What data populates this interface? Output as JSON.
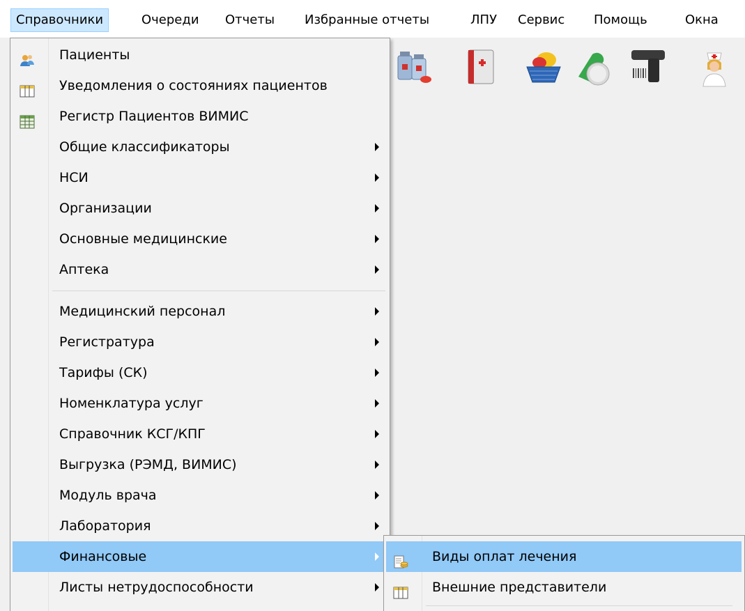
{
  "menubar": {
    "items": [
      {
        "label": "Справочники"
      },
      {
        "label": "Очереди"
      },
      {
        "label": "Отчеты"
      },
      {
        "label": "Избранные отчеты"
      },
      {
        "label": "ЛПУ"
      },
      {
        "label": "Сервис"
      },
      {
        "label": "Помощь"
      },
      {
        "label": "Окна"
      }
    ]
  },
  "toolbar": {
    "icons": [
      "medicine-vials-icon",
      "first-aid-book-icon",
      "pills-basket-icon",
      "capsule-tablet-icon",
      "barcode-scanner-icon",
      "nurse-icon"
    ]
  },
  "menu": {
    "items": [
      {
        "label": "Пациенты",
        "icon": "patients-icon",
        "has_submenu": false
      },
      {
        "label": "Уведомления о состояниях пациентов",
        "icon": "table-columns-icon",
        "has_submenu": false
      },
      {
        "label": "Регистр Пациентов ВИМИС",
        "icon": "spreadsheet-icon",
        "has_submenu": false
      },
      {
        "label": "Общие классификаторы",
        "has_submenu": true
      },
      {
        "label": "НСИ",
        "has_submenu": true
      },
      {
        "label": "Организации",
        "has_submenu": true
      },
      {
        "label": "Основные медицинские",
        "has_submenu": true
      },
      {
        "label": "Аптека",
        "has_submenu": true
      },
      {
        "label": "Медицинский персонал",
        "has_submenu": true
      },
      {
        "label": "Регистратура",
        "has_submenu": true
      },
      {
        "label": "Тарифы (СК)",
        "has_submenu": true
      },
      {
        "label": "Номенклатура услуг",
        "has_submenu": true
      },
      {
        "label": "Справочник КСГ/КПГ",
        "has_submenu": true
      },
      {
        "label": "Выгрузка (РЭМД, ВИМИС)",
        "has_submenu": true
      },
      {
        "label": "Модуль врача",
        "has_submenu": true
      },
      {
        "label": "Лаборатория",
        "has_submenu": true
      },
      {
        "label": "Финансовые",
        "has_submenu": true,
        "highlighted": true
      },
      {
        "label": "Листы нетрудоспособности",
        "has_submenu": true
      }
    ]
  },
  "submenu": {
    "items": [
      {
        "label": "Виды оплат лечения",
        "icon": "payment-types-icon",
        "highlighted": true
      },
      {
        "label": "Внешние представители",
        "icon": "table-columns-icon"
      }
    ]
  },
  "colors": {
    "highlight": "#91c9f7",
    "menubar_open": "#cce8ff",
    "menu_bg": "#f2f2f2"
  }
}
